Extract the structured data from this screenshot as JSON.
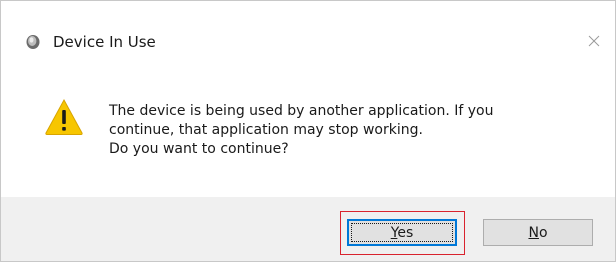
{
  "window": {
    "title": "Device In Use",
    "app_icon": "speaker-icon",
    "close_icon": "close-icon"
  },
  "message": {
    "icon": "warning-icon",
    "lines": [
      "The device is being used by another application.  If you",
      "continue, that application may stop working.",
      "Do you want to continue?"
    ]
  },
  "buttons": {
    "yes": {
      "mnemonic": "Y",
      "rest": "es",
      "full_label": "Yes",
      "default": true
    },
    "no": {
      "mnemonic": "N",
      "rest": "o",
      "full_label": "No"
    }
  },
  "colors": {
    "footer_bg": "#f0f0f0",
    "highlight_border": "#d9232e",
    "default_button_border": "#0078d7",
    "warning_fill": "#f7c600"
  }
}
